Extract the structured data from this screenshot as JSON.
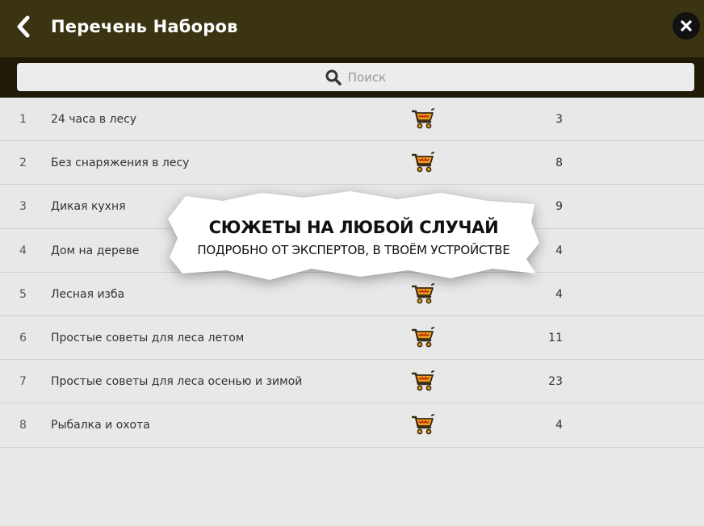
{
  "header": {
    "title": "Перечень Наборов",
    "back_icon": "chevron-left-icon",
    "close_icon": "close-icon"
  },
  "search": {
    "placeholder": "Поиск",
    "icon": "search-icon"
  },
  "items": [
    {
      "num": "1",
      "name": "24 часа в лесу",
      "count": "3"
    },
    {
      "num": "2",
      "name": "Без снаряжения в лесу",
      "count": "8"
    },
    {
      "num": "3",
      "name": "Дикая кухня",
      "count": "9"
    },
    {
      "num": "4",
      "name": "Дом на дереве",
      "count": "4"
    },
    {
      "num": "5",
      "name": "Лесная изба",
      "count": "4"
    },
    {
      "num": "6",
      "name": "Простые советы для леса летом",
      "count": "11"
    },
    {
      "num": "7",
      "name": "Простые советы для леса осенью и зимой",
      "count": "23"
    },
    {
      "num": "8",
      "name": "Рыбалка и охота",
      "count": "4"
    }
  ],
  "promo": {
    "title": "СЮЖЕТЫ НА ЛЮБОЙ СЛУЧАЙ",
    "subtitle": "ПОДРОБНО ОТ ЭКСПЕРТОВ, В ТВОЁМ УСТРОЙСТВЕ"
  },
  "colors": {
    "header_bg": "#3a3412",
    "search_bar_bg": "#1f1b06",
    "cart_orange": "#f0a020"
  }
}
